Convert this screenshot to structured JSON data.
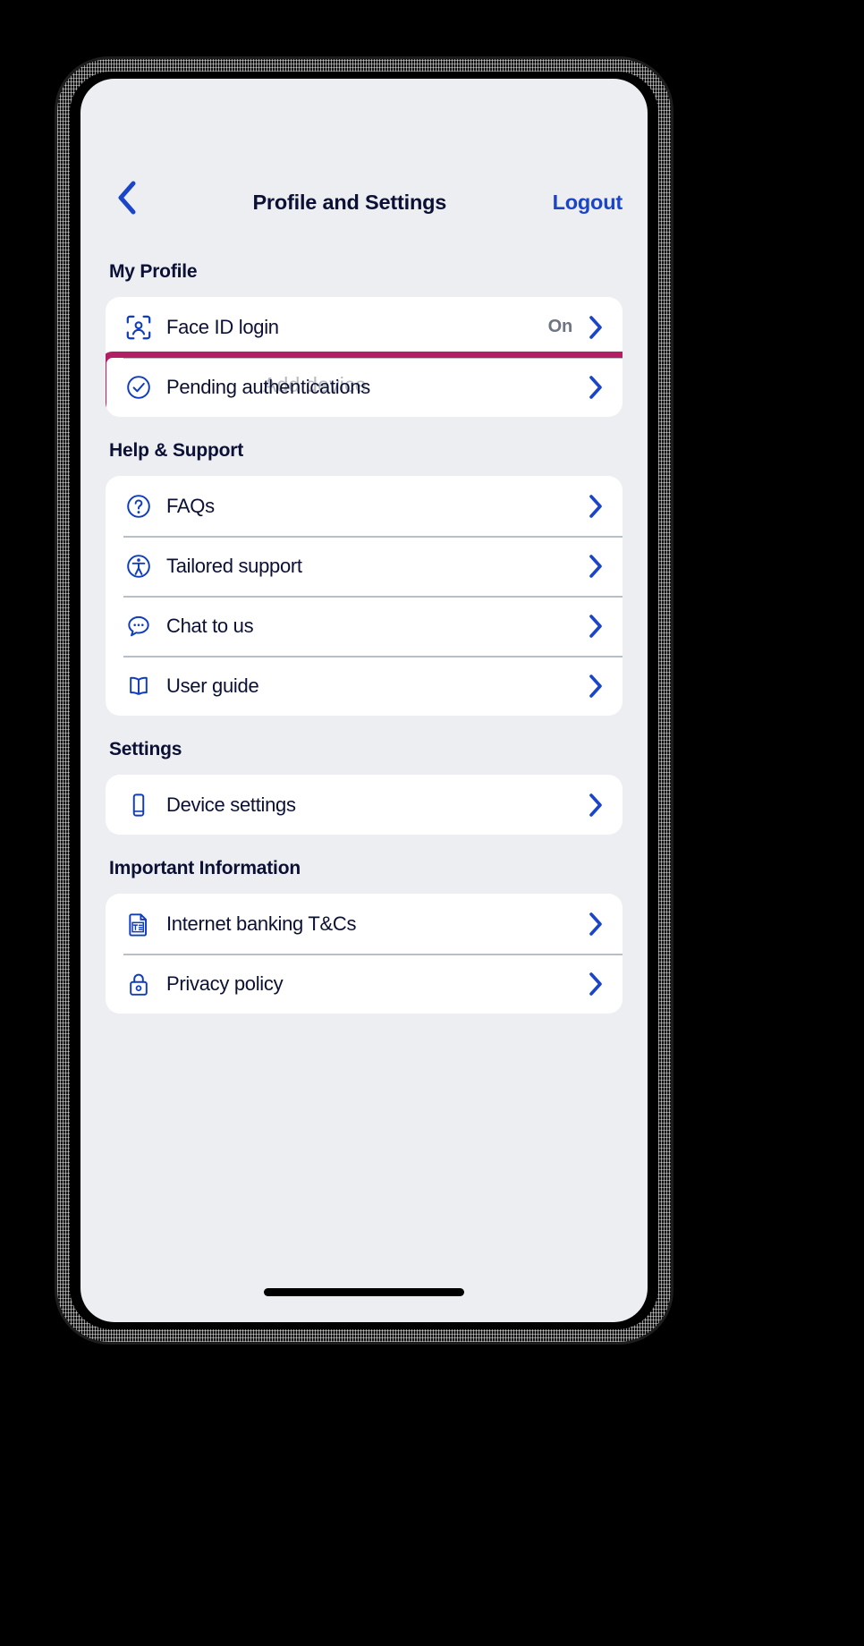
{
  "header": {
    "back_icon": "chevron-left-icon",
    "title": "Profile and Settings",
    "logout_label": "Logout"
  },
  "artifact": {
    "ghost_text": "Add device"
  },
  "colors": {
    "accent_blue": "#1a45c8",
    "icon_blue": "#0f3dbd",
    "text_navy": "#0b1034",
    "value_grey": "#6e7482",
    "highlight_magenta": "#b31f63",
    "screen_bg": "#eceef2",
    "card_bg": "#ffffff",
    "divider": "#b9bfc9"
  },
  "sections": [
    {
      "title": "My Profile",
      "rows": [
        {
          "icon": "face-id-icon",
          "label": "Face ID login",
          "value": "On",
          "chevron": "chevron-right-icon",
          "highlighted": false
        },
        {
          "icon": "check-circle-icon",
          "label": "Pending authentications",
          "value": "",
          "chevron": "chevron-right-icon",
          "highlighted": true
        }
      ]
    },
    {
      "title": "Help & Support",
      "rows": [
        {
          "icon": "question-circle-icon",
          "label": "FAQs",
          "value": "",
          "chevron": "chevron-right-icon",
          "highlighted": false
        },
        {
          "icon": "accessibility-icon",
          "label": "Tailored support",
          "value": "",
          "chevron": "chevron-right-icon",
          "highlighted": false
        },
        {
          "icon": "chat-bubble-icon",
          "label": "Chat to us",
          "value": "",
          "chevron": "chevron-right-icon",
          "highlighted": false
        },
        {
          "icon": "open-book-icon",
          "label": "User guide",
          "value": "",
          "chevron": "chevron-right-icon",
          "highlighted": false
        }
      ]
    },
    {
      "title": "Settings",
      "rows": [
        {
          "icon": "mobile-phone-icon",
          "label": "Device settings",
          "value": "",
          "chevron": "chevron-right-icon",
          "highlighted": false
        }
      ]
    },
    {
      "title": "Important Information",
      "rows": [
        {
          "icon": "document-text-icon",
          "label": "Internet banking T&Cs",
          "value": "",
          "chevron": "chevron-right-icon",
          "highlighted": false
        },
        {
          "icon": "padlock-icon",
          "label": "Privacy policy",
          "value": "",
          "chevron": "chevron-right-icon",
          "highlighted": false
        }
      ]
    }
  ],
  "system": {
    "home_indicator": "home-indicator"
  }
}
